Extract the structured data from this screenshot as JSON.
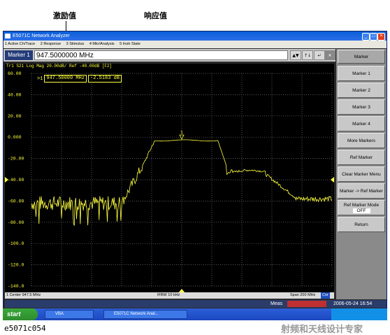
{
  "annotations": {
    "excitation_label": "激励值",
    "response_label": "响应值"
  },
  "window": {
    "title": "E5071C Network Analyzer",
    "controls": [
      "_",
      "□",
      "×"
    ]
  },
  "menubar": {
    "items": [
      "1 Active Ch/Trace",
      "2 Response",
      "3 Stimulus",
      "4 Mkr/Analysis",
      "5 Instr State"
    ]
  },
  "entry": {
    "label": "Marker 1",
    "value": "947.5000000 MHz"
  },
  "trace": {
    "header": "Tr1 S21 Log Mag 20.00dB/ Ref -40.00dB [F2]",
    "marker_readout": {
      "id": ">1",
      "frequency": "947.50000 MHz",
      "value": "-2.5183 dB"
    },
    "marker_flag": "1",
    "y_ticks": [
      "60.00",
      "40.00",
      "20.00",
      "0.000",
      "-20.00",
      "-40.00",
      "-60.00",
      "-80.00",
      "-100.0",
      "-120.0",
      "-140.0"
    ],
    "y_range_db": [
      -140,
      60
    ],
    "ref_level_db": -40,
    "color": "#ffff40"
  },
  "footer": {
    "center": "1 Center 947.5 MHz",
    "ifbw": "IFBW 10 kHz",
    "span": "Span 200 MHz",
    "cor": "Cor"
  },
  "status": {
    "meas": "Meas",
    "datetime": "2006-05-24 16:54"
  },
  "softkeys": {
    "title": "Marker",
    "items": [
      "Marker 1",
      "Marker 2",
      "Marker 3",
      "Marker 4",
      "More Markers",
      "Ref Marker",
      "Clear Marker Menu",
      "Marker -> Ref Marker",
      "Ref Marker Mode",
      "Return"
    ],
    "ref_marker_mode_value": "OFF"
  },
  "taskbar": {
    "start": "start",
    "items": [
      "VBA",
      "E5071C Network Anal..."
    ]
  },
  "caption": "e5071c054",
  "watermark": "射频和天线设计专家"
}
